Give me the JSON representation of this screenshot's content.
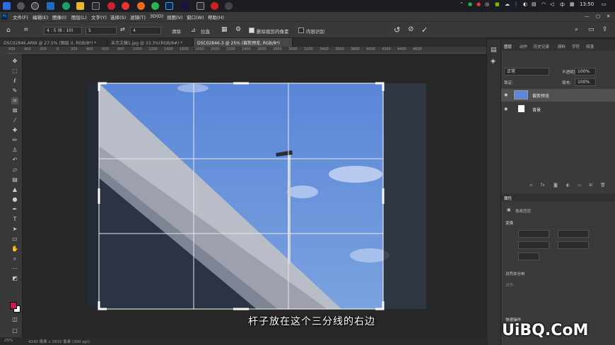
{
  "taskbar": {
    "tray_lang": "中",
    "tray_time": "13:50"
  },
  "menubar": {
    "items": [
      "文件(F)",
      "编辑(E)",
      "图像(I)",
      "图层(L)",
      "文字(Y)",
      "选择(S)",
      "滤镜(T)",
      "3D(D)",
      "视图(V)",
      "窗口(W)",
      "帮助(H)"
    ]
  },
  "options": {
    "ratio": "4 : 5 (8 : 10)",
    "width": "5",
    "height": "4",
    "clear": "清除",
    "straighten": "拉直",
    "delete_cropped": "删除裁剪的像素",
    "content_aware": "内容识别"
  },
  "tabs": [
    "DSC02846.ARW @ 27.5% (图层 0, RGB/8*) *",
    "未示文稿1.jpg @ 33.3%(RGB/8#) *",
    "DSC02846-3 @ 25% (裁剪预览, RGB/8*)"
  ],
  "ruler": [
    "600",
    "400",
    "200",
    "0",
    "200",
    "400",
    "600",
    "800",
    "1000",
    "1200",
    "1400",
    "1600",
    "1800",
    "2000",
    "2200",
    "2400",
    "2600",
    "2800",
    "3000",
    "3200",
    "3400",
    "3600",
    "3800",
    "4000",
    "4200",
    "4400",
    "4600"
  ],
  "panels": {
    "tabs": [
      "图层",
      "动作",
      "历史记录",
      "颜料",
      "字符",
      "段落"
    ],
    "blend_mode": "正常",
    "opacity_label": "不透明度:",
    "opacity": "100%",
    "lock_label": "锁定:",
    "fill_label": "填充:",
    "fill": "100%",
    "layers": [
      {
        "name": "裁剪预览"
      },
      {
        "name": "背景"
      }
    ],
    "properties_title": "属性",
    "pixel_layer": "像素图层",
    "transform_title": "变换",
    "align_title": "对齐并分布",
    "align_sub": "对齐:",
    "quick_actions": "快速操作"
  },
  "status": {
    "zoom": "25%",
    "doc_info": "4240 像素 x 2832 像素 (300 ppi)"
  },
  "subtitle": "杆子放在这个三分线的右边",
  "watermark": "UiBQ.CoM",
  "colors": {
    "sky": "#5b87d6",
    "foreground": "#d8114f",
    "background": "#ffffff"
  }
}
